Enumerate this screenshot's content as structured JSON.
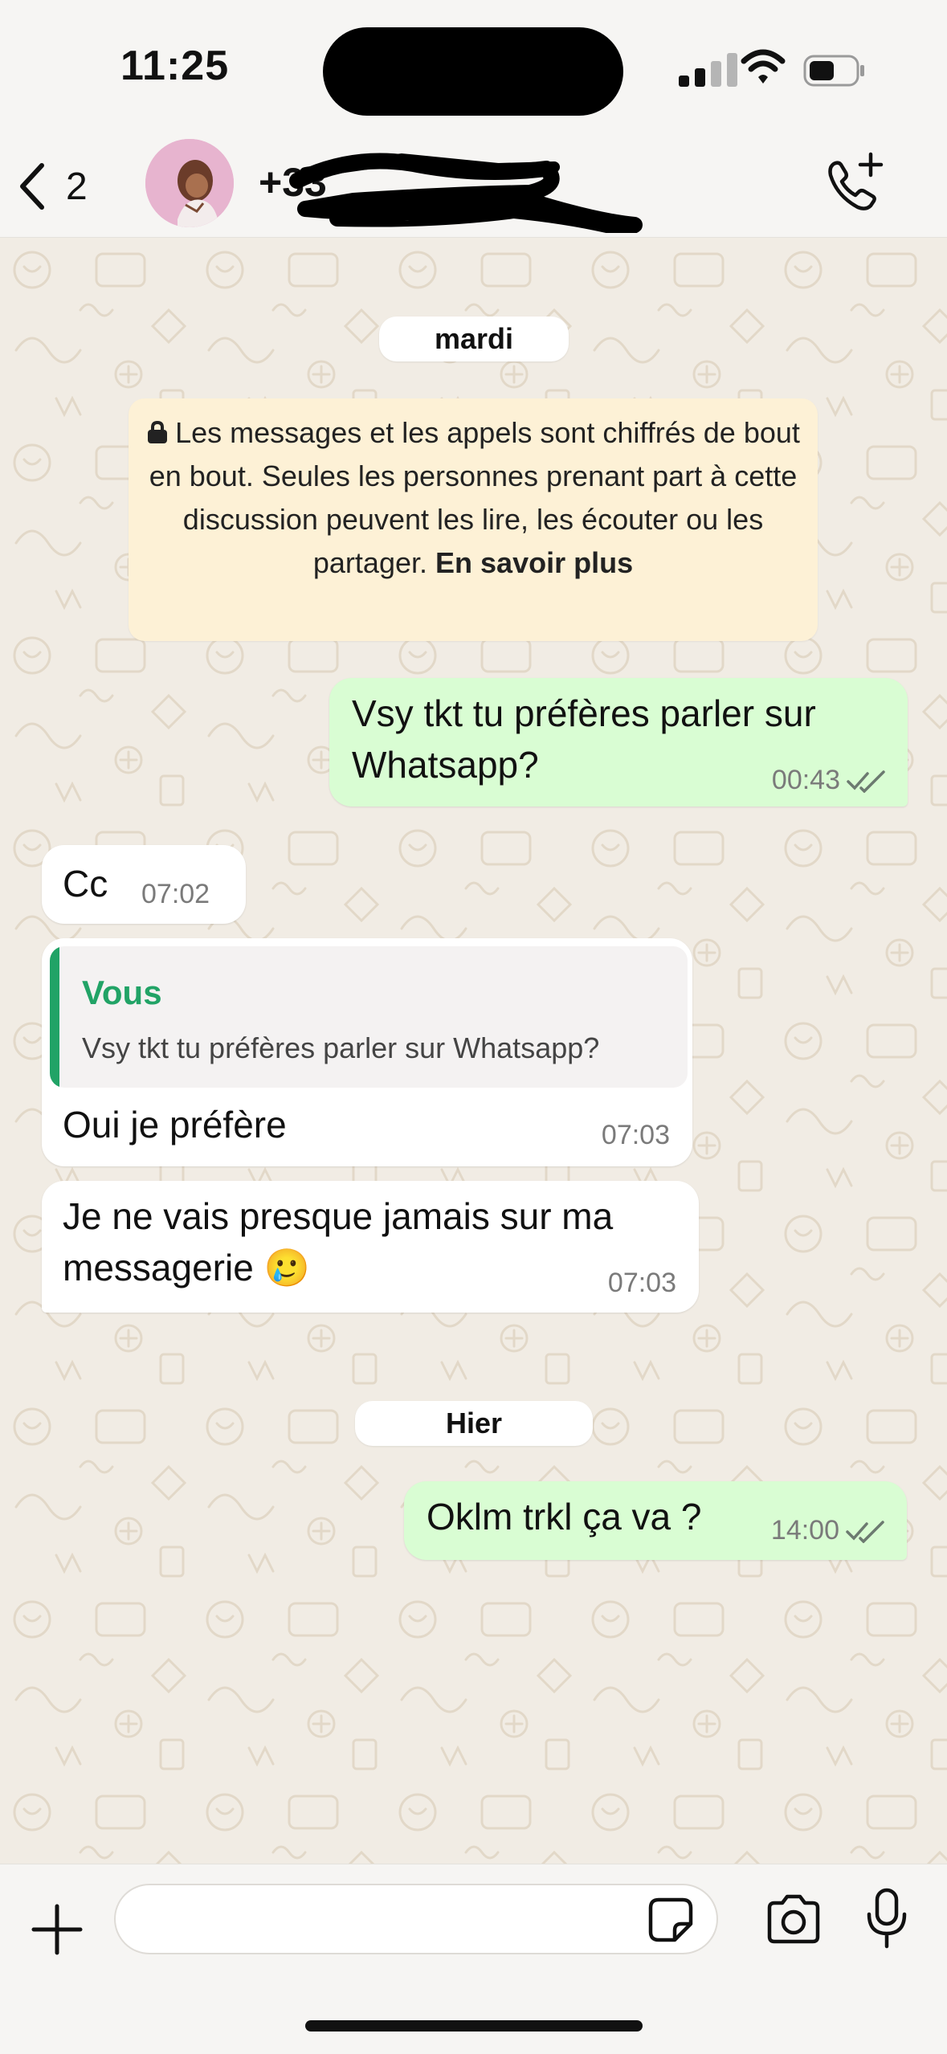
{
  "status": {
    "time": "11:25"
  },
  "header": {
    "back_count": "2",
    "contact_name": "+33"
  },
  "chat": {
    "date_1": "mardi",
    "encryption_notice": {
      "text": "Les messages et les appels sont chiffrés de bout en bout. Seules les personnes prenant part à cette discussion peuvent les lire, les écouter ou les partager.",
      "link": "En savoir plus"
    },
    "messages": [
      {
        "direction": "out",
        "text": "Vsy tkt tu préfères parler sur Whatsapp?",
        "time": "00:43",
        "status": "read"
      },
      {
        "direction": "in",
        "text": "Cc",
        "time": "07:02"
      },
      {
        "direction": "in",
        "quote_author": "Vous",
        "quote_text": "Vsy tkt tu préfères parler sur Whatsapp?",
        "text": "Oui je préfère",
        "time": "07:03"
      },
      {
        "direction": "in",
        "text": "Je ne vais presque jamais sur ma messagerie 🥲",
        "time": "07:03"
      }
    ],
    "date_2": "Hier",
    "messages_2": [
      {
        "direction": "out",
        "text": "Oklm trkl ça va ?",
        "time": "14:00",
        "status": "read"
      }
    ]
  },
  "composer": {
    "placeholder": ""
  },
  "colors": {
    "accent": "#21a366",
    "outgoing_bubble": "#d9fdd3",
    "incoming_bubble": "#ffffff",
    "notice_bg": "#fdf1d6"
  },
  "icons": [
    "back-chevron-icon",
    "call-add-icon",
    "lock-icon",
    "double-check-icon",
    "plus-icon",
    "sticker-icon",
    "camera-icon",
    "mic-icon"
  ]
}
